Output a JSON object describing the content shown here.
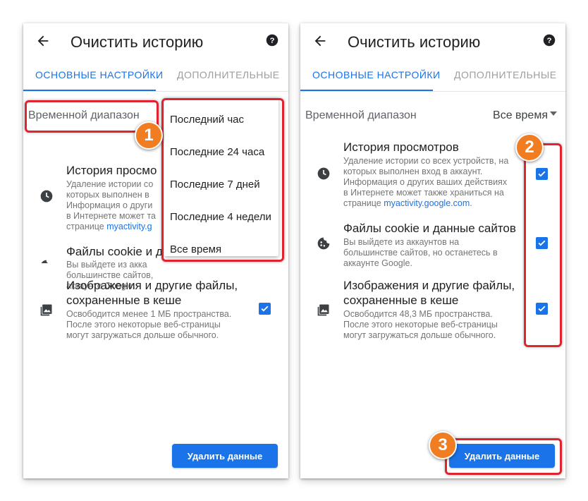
{
  "left": {
    "title": "Очистить историю",
    "tabs": {
      "basic": "ОСНОВНЫЕ НАСТРОЙКИ",
      "advanced": "ДОПОЛНИТЕЛЬНЫЕ"
    },
    "time_range_label": "Временной диапазон",
    "rows": [
      {
        "title": "История просмо",
        "desc": [
          "Удаление истории со",
          "которых выполнен в",
          "Информация о други",
          "в Интернете может та"
        ],
        "link_prefix": "странице ",
        "link": "myactivity.g",
        "icon": "clock-icon",
        "checked": true
      },
      {
        "title": "Файлы cookie и д",
        "desc": [
          "Вы выйдете из акка",
          "большинстве сайтов,",
          "аккаунте Google."
        ],
        "icon": "cookie-icon",
        "checked": true
      },
      {
        "title_lines": [
          "Изображения и другие файлы,",
          "сохраненные в кеше"
        ],
        "desc": [
          "Освободится менее 1 МБ пространства.",
          "После этого некоторые веб-страницы",
          "могут загружаться дольше обычного."
        ],
        "icon": "image-icon",
        "checked": true
      }
    ],
    "dropdown_options": [
      "Последний час",
      "Последние 24 часа",
      "Последние 7 дней",
      "Последние 4 недели",
      "Все время"
    ],
    "delete_button": "Удалить данные",
    "marker": "1"
  },
  "right": {
    "title": "Очистить историю",
    "tabs": {
      "basic": "ОСНОВНЫЕ НАСТРОЙКИ",
      "advanced": "ДОПОЛНИТЕЛЬНЫЕ"
    },
    "time_range_label": "Временной диапазон",
    "time_range_value": "Все время",
    "rows": [
      {
        "title": "История просмотров",
        "desc": [
          "Удаление истории со всех устройств, на",
          "которых выполнен вход в аккаунт.",
          "Информация о других ваших действиях",
          "в Интернете может также храниться на"
        ],
        "link_prefix": "странице ",
        "link": "myactivity.google.com",
        "link_suffix": ".",
        "icon": "clock-icon",
        "checked": true
      },
      {
        "title": "Файлы cookie и данные сайтов",
        "desc": [
          "Вы выйдете из аккаунтов на",
          "большинстве сайтов, но останетесь в",
          "аккаунте Google."
        ],
        "icon": "cookie-icon",
        "checked": true
      },
      {
        "title_lines": [
          "Изображения и другие файлы,",
          "сохраненные в кеше"
        ],
        "desc": [
          "Освободится 48,3 МБ пространства.",
          "После этого некоторые веб-страницы",
          "могут загружаться дольше обычного."
        ],
        "icon": "image-icon",
        "checked": true
      }
    ],
    "delete_button": "Удалить данные",
    "markers": [
      "2",
      "3"
    ]
  },
  "colors": {
    "accent": "#1a73e8",
    "highlight": "#e0232f",
    "marker": "#f07d22"
  }
}
